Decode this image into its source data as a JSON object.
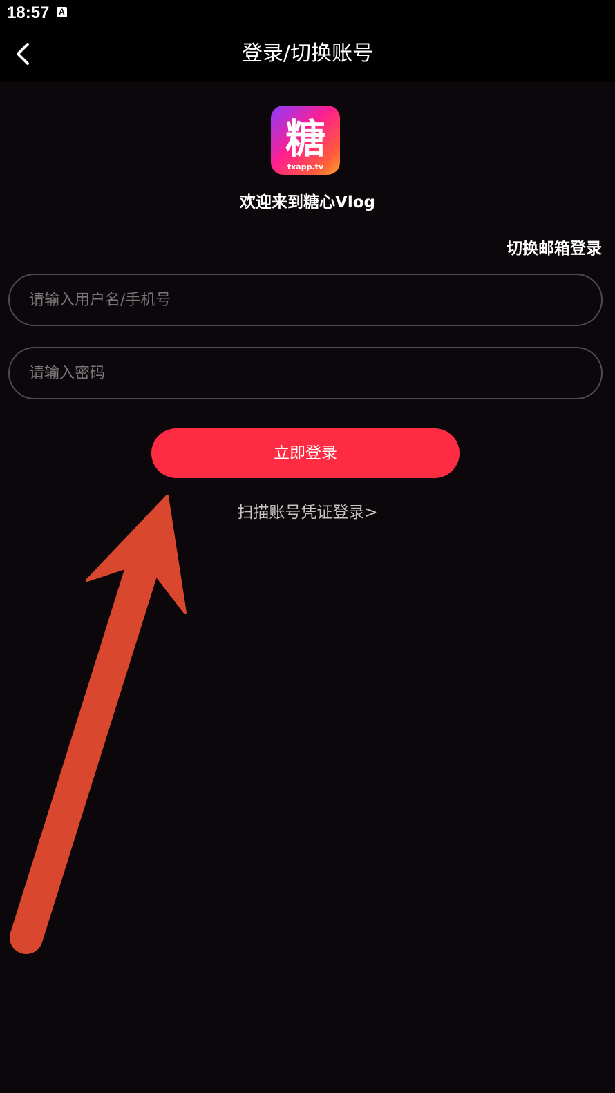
{
  "status_bar": {
    "time": "18:57",
    "notification_icon": "a-icon",
    "notification_glyph": "A"
  },
  "nav": {
    "back_icon": "chevron-left-icon",
    "title": "登录/切换账号"
  },
  "logo": {
    "char": "糖",
    "domain": "txapp.tv"
  },
  "welcome": "欢迎来到糖心Vlog",
  "switch_email_login": "切换邮箱登录",
  "form": {
    "username_placeholder": "请输入用户名/手机号",
    "username_value": "",
    "password_placeholder": "请输入密码",
    "password_value": ""
  },
  "login_button": "立即登录",
  "scan_credential_login": "扫描账号凭证登录>",
  "colors": {
    "background": "#0c070a",
    "bar": "#000000",
    "accent": "#fe2c42",
    "input_border": "#4f4a4d",
    "placeholder": "#7b7679",
    "secondary_text": "#c5c2c4",
    "annotation_arrow": "#d9472f"
  },
  "annotation": {
    "icon": "red-arrow-icon"
  }
}
